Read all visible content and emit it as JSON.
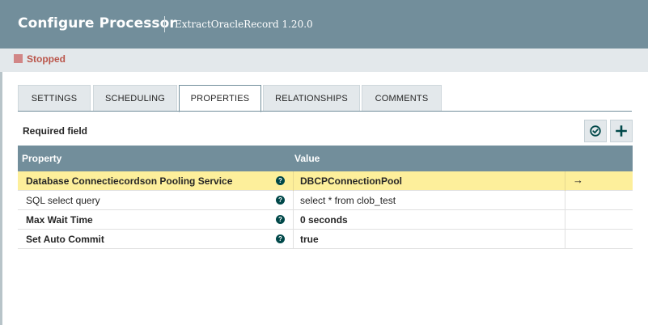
{
  "header": {
    "title": "Configure Processor",
    "subtitle": "ExtractOracleRecord 1.20.0"
  },
  "status": {
    "label": "Stopped",
    "color": "#d18686"
  },
  "tabs": [
    {
      "label": "SETTINGS",
      "active": false
    },
    {
      "label": "SCHEDULING",
      "active": false
    },
    {
      "label": "PROPERTIES",
      "active": true
    },
    {
      "label": "RELATIONSHIPS",
      "active": false
    },
    {
      "label": "COMMENTS",
      "active": false
    }
  ],
  "required_label": "Required field",
  "actions": [
    {
      "name": "verify-properties",
      "icon": "check-circle-icon"
    },
    {
      "name": "add-property",
      "icon": "plus-icon"
    }
  ],
  "table": {
    "columns": [
      "Property",
      "Value"
    ],
    "rows": [
      {
        "name": "Database Connectiecordson Pooling Service",
        "value": "DBCPConnectionPool",
        "required": true,
        "selected": true,
        "action_icon": "arrow-right-icon",
        "action_glyph": "→"
      },
      {
        "name": "SQL select query",
        "value": "select * from clob_test",
        "required": false,
        "selected": false
      },
      {
        "name": "Max Wait Time",
        "value": "0 seconds",
        "required": true,
        "selected": false
      },
      {
        "name": "Set Auto Commit",
        "value": "true",
        "required": true,
        "selected": false
      }
    ]
  },
  "help_glyph": "?",
  "colors": {
    "header_bg": "#728e9b",
    "selected_row": "#fdef9b",
    "help_icon": "#004849"
  }
}
